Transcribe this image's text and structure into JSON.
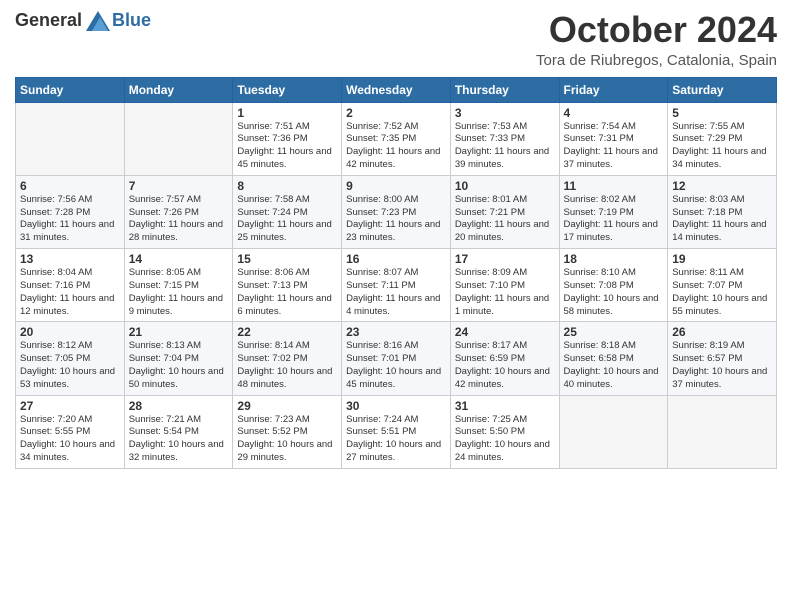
{
  "logo": {
    "general": "General",
    "blue": "Blue"
  },
  "header": {
    "month": "October 2024",
    "location": "Tora de Riubregos, Catalonia, Spain"
  },
  "weekdays": [
    "Sunday",
    "Monday",
    "Tuesday",
    "Wednesday",
    "Thursday",
    "Friday",
    "Saturday"
  ],
  "weeks": [
    [
      {
        "day": "",
        "info": ""
      },
      {
        "day": "",
        "info": ""
      },
      {
        "day": "1",
        "info": "Sunrise: 7:51 AM\nSunset: 7:36 PM\nDaylight: 11 hours and 45 minutes."
      },
      {
        "day": "2",
        "info": "Sunrise: 7:52 AM\nSunset: 7:35 PM\nDaylight: 11 hours and 42 minutes."
      },
      {
        "day": "3",
        "info": "Sunrise: 7:53 AM\nSunset: 7:33 PM\nDaylight: 11 hours and 39 minutes."
      },
      {
        "day": "4",
        "info": "Sunrise: 7:54 AM\nSunset: 7:31 PM\nDaylight: 11 hours and 37 minutes."
      },
      {
        "day": "5",
        "info": "Sunrise: 7:55 AM\nSunset: 7:29 PM\nDaylight: 11 hours and 34 minutes."
      }
    ],
    [
      {
        "day": "6",
        "info": "Sunrise: 7:56 AM\nSunset: 7:28 PM\nDaylight: 11 hours and 31 minutes."
      },
      {
        "day": "7",
        "info": "Sunrise: 7:57 AM\nSunset: 7:26 PM\nDaylight: 11 hours and 28 minutes."
      },
      {
        "day": "8",
        "info": "Sunrise: 7:58 AM\nSunset: 7:24 PM\nDaylight: 11 hours and 25 minutes."
      },
      {
        "day": "9",
        "info": "Sunrise: 8:00 AM\nSunset: 7:23 PM\nDaylight: 11 hours and 23 minutes."
      },
      {
        "day": "10",
        "info": "Sunrise: 8:01 AM\nSunset: 7:21 PM\nDaylight: 11 hours and 20 minutes."
      },
      {
        "day": "11",
        "info": "Sunrise: 8:02 AM\nSunset: 7:19 PM\nDaylight: 11 hours and 17 minutes."
      },
      {
        "day": "12",
        "info": "Sunrise: 8:03 AM\nSunset: 7:18 PM\nDaylight: 11 hours and 14 minutes."
      }
    ],
    [
      {
        "day": "13",
        "info": "Sunrise: 8:04 AM\nSunset: 7:16 PM\nDaylight: 11 hours and 12 minutes."
      },
      {
        "day": "14",
        "info": "Sunrise: 8:05 AM\nSunset: 7:15 PM\nDaylight: 11 hours and 9 minutes."
      },
      {
        "day": "15",
        "info": "Sunrise: 8:06 AM\nSunset: 7:13 PM\nDaylight: 11 hours and 6 minutes."
      },
      {
        "day": "16",
        "info": "Sunrise: 8:07 AM\nSunset: 7:11 PM\nDaylight: 11 hours and 4 minutes."
      },
      {
        "day": "17",
        "info": "Sunrise: 8:09 AM\nSunset: 7:10 PM\nDaylight: 11 hours and 1 minute."
      },
      {
        "day": "18",
        "info": "Sunrise: 8:10 AM\nSunset: 7:08 PM\nDaylight: 10 hours and 58 minutes."
      },
      {
        "day": "19",
        "info": "Sunrise: 8:11 AM\nSunset: 7:07 PM\nDaylight: 10 hours and 55 minutes."
      }
    ],
    [
      {
        "day": "20",
        "info": "Sunrise: 8:12 AM\nSunset: 7:05 PM\nDaylight: 10 hours and 53 minutes."
      },
      {
        "day": "21",
        "info": "Sunrise: 8:13 AM\nSunset: 7:04 PM\nDaylight: 10 hours and 50 minutes."
      },
      {
        "day": "22",
        "info": "Sunrise: 8:14 AM\nSunset: 7:02 PM\nDaylight: 10 hours and 48 minutes."
      },
      {
        "day": "23",
        "info": "Sunrise: 8:16 AM\nSunset: 7:01 PM\nDaylight: 10 hours and 45 minutes."
      },
      {
        "day": "24",
        "info": "Sunrise: 8:17 AM\nSunset: 6:59 PM\nDaylight: 10 hours and 42 minutes."
      },
      {
        "day": "25",
        "info": "Sunrise: 8:18 AM\nSunset: 6:58 PM\nDaylight: 10 hours and 40 minutes."
      },
      {
        "day": "26",
        "info": "Sunrise: 8:19 AM\nSunset: 6:57 PM\nDaylight: 10 hours and 37 minutes."
      }
    ],
    [
      {
        "day": "27",
        "info": "Sunrise: 7:20 AM\nSunset: 5:55 PM\nDaylight: 10 hours and 34 minutes."
      },
      {
        "day": "28",
        "info": "Sunrise: 7:21 AM\nSunset: 5:54 PM\nDaylight: 10 hours and 32 minutes."
      },
      {
        "day": "29",
        "info": "Sunrise: 7:23 AM\nSunset: 5:52 PM\nDaylight: 10 hours and 29 minutes."
      },
      {
        "day": "30",
        "info": "Sunrise: 7:24 AM\nSunset: 5:51 PM\nDaylight: 10 hours and 27 minutes."
      },
      {
        "day": "31",
        "info": "Sunrise: 7:25 AM\nSunset: 5:50 PM\nDaylight: 10 hours and 24 minutes."
      },
      {
        "day": "",
        "info": ""
      },
      {
        "day": "",
        "info": ""
      }
    ]
  ]
}
